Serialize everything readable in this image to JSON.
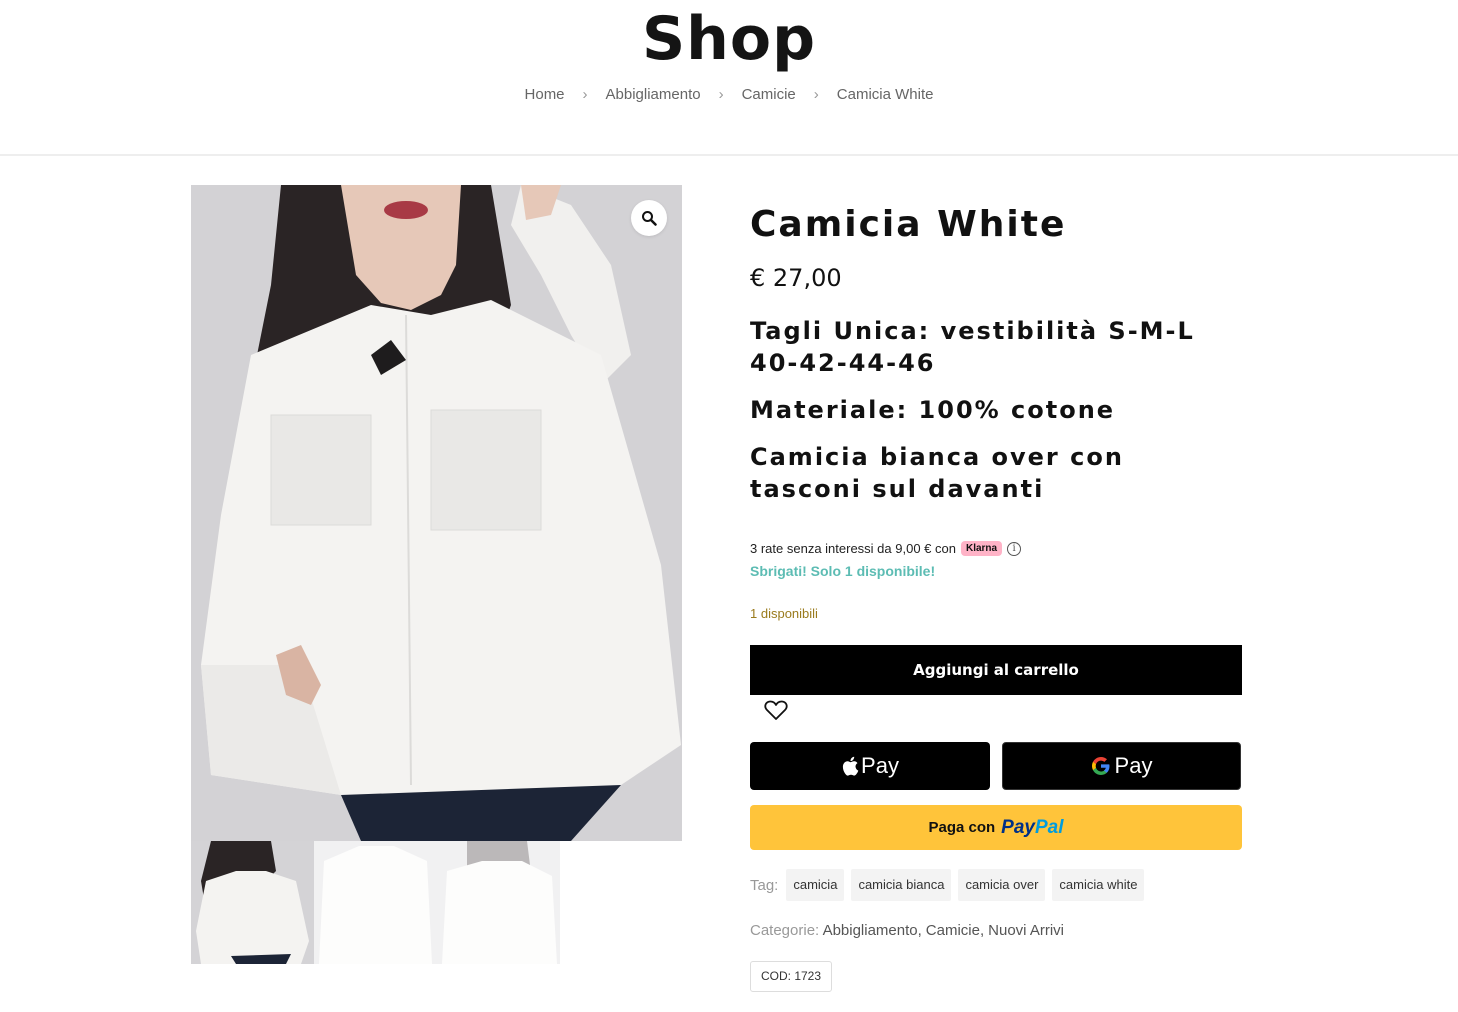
{
  "header": {
    "title": "Shop",
    "breadcrumb": [
      "Home",
      "Abbigliamento",
      "Camicie",
      "Camicia White"
    ]
  },
  "product": {
    "title": "Camicia White",
    "price": "€ 27,00",
    "description": [
      "Tagli Unica: vestibilità S-M-L  40-42-44-46",
      "Materiale: 100% cotone",
      "Camicia bianca over con tasconi sul davanti"
    ],
    "klarna": {
      "text": "3 rate senza interessi da 9,00 € con",
      "badge": "Klarna"
    },
    "urgency": "Sbrigati! Solo 1 disponibile!",
    "stock": "1 disponibili",
    "add_to_cart": "Aggiungi al carrello",
    "apple_pay": "Pay",
    "google_pay": "Pay",
    "paypal": {
      "prefix": "Paga con",
      "logo_dark": "Pay",
      "logo_light": "Pal"
    },
    "tags_label": "Tag:",
    "tags": [
      "camicia",
      "camicia bianca",
      "camicia over",
      "camicia white"
    ],
    "categories_label": "Categorie:",
    "categories": [
      "Abbigliamento",
      "Camicie",
      "Nuovi Arrivi"
    ],
    "sku": "COD: 1723"
  },
  "icons": {
    "zoom": "magnifier-icon",
    "wishlist": "heart-icon",
    "separator": "chevron-right-icon",
    "info": "info-icon"
  },
  "colors": {
    "accent_urgency": "#5cbcb3",
    "stock": "#9a7b1d",
    "paypal_bg": "#ffc43a",
    "klarna_badge": "#ffb3c7"
  }
}
